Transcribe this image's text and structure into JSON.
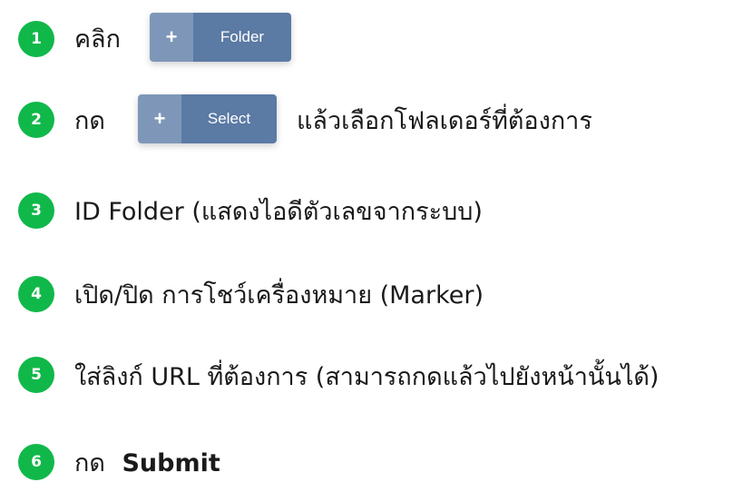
{
  "steps": [
    {
      "number": "1",
      "text": "คลิก",
      "button": {
        "icon": "+",
        "label": "Folder"
      }
    },
    {
      "number": "2",
      "text_before": "กด",
      "button": {
        "icon": "+",
        "label": "Select"
      },
      "text_after": "แล้วเลือกโฟลเดอร์ที่ต้องการ"
    },
    {
      "number": "3",
      "text": "ID Folder (แสดงไอดีตัวเลขจากระบบ)"
    },
    {
      "number": "4",
      "text": "เปิด/ปิด การโชว์เครื่องหมาย (Marker)"
    },
    {
      "number": "5",
      "text": "ใส่ลิงก์ URL ที่ต้องการ (สามารถกดแล้วไปยังหน้านั้นได้)"
    },
    {
      "number": "6",
      "text_before": "กด",
      "text_bold": "Submit"
    }
  ],
  "colors": {
    "badge": "#10b84a",
    "button_icon_bg": "#7e97b8",
    "button_label_bg": "#5b7aa4"
  }
}
